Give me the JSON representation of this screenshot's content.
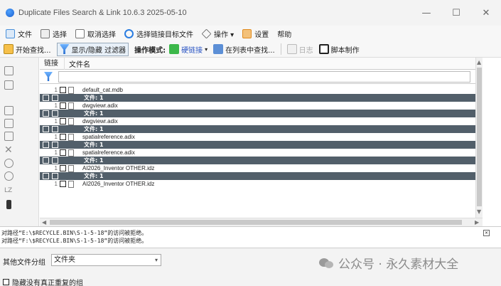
{
  "window": {
    "title": "Duplicate Files Search & Link 10.6.3 2025-05-10",
    "controls": [
      "—",
      "☐",
      "✕"
    ]
  },
  "menu": {
    "items": [
      {
        "label": "文件",
        "icon": "file-icon",
        "color": "#4a90d9"
      },
      {
        "label": "选择",
        "icon": "select-icon",
        "color": "#777777"
      },
      {
        "label": "取消选择",
        "icon": "deselect-icon",
        "color": "#777777"
      },
      {
        "label": "选择链接目标文件",
        "icon": "target-icon",
        "color": "#2a7de1"
      },
      {
        "label": "操作 ▾",
        "icon": "diamond-icon",
        "color": "#555555"
      },
      {
        "label": "设置",
        "icon": "settings-icon",
        "color": "#e08a1e"
      },
      {
        "label": "帮助",
        "icon": "",
        "color": ""
      }
    ]
  },
  "toolbar": {
    "start_search": "开始查找...",
    "filter_toggle": "显示/隐藏 过滤器",
    "mode_label": "操作模式:",
    "mode_value": "硬链接",
    "find_in_list": "在列表中查找...",
    "log": "日志",
    "script": "脚本制作"
  },
  "list": {
    "columns": {
      "link": "链接",
      "name": "文件名"
    },
    "group_label": "文件:  1",
    "rows": [
      {
        "type": "file",
        "num": "1",
        "name": "default_cat.mdb"
      },
      {
        "type": "group"
      },
      {
        "type": "file",
        "num": "1",
        "name": "dwgviewr.adix"
      },
      {
        "type": "group"
      },
      {
        "type": "file",
        "num": "1",
        "name": "dwgviewr.adix"
      },
      {
        "type": "group"
      },
      {
        "type": "file",
        "num": "1",
        "name": "spatialreference.adix"
      },
      {
        "type": "group"
      },
      {
        "type": "file",
        "num": "1",
        "name": "spatialreference.adix"
      },
      {
        "type": "group"
      },
      {
        "type": "file",
        "num": "1",
        "name": "AI2026_Inventor OTHER.idz"
      },
      {
        "type": "group"
      },
      {
        "type": "file",
        "num": "1",
        "name": "AI2026_Inventor OTHER.idz"
      }
    ]
  },
  "log": {
    "lines": [
      "对路径“E:\\$RECYCLE.BIN\\S-1-5-18”的访问被拒绝。",
      "对路径“F:\\$RECYCLE.BIN\\S-1-5-18”的访问被拒绝。"
    ]
  },
  "bottom": {
    "group_label": "其他文件分组",
    "group_select": "文件夹",
    "hide_label": "隐藏没有真正重复的组",
    "watermark": "公众号 · 永久素材大全"
  },
  "colors": {
    "group_row_bg": "#525f6a",
    "accent": "#1b5fcf"
  }
}
